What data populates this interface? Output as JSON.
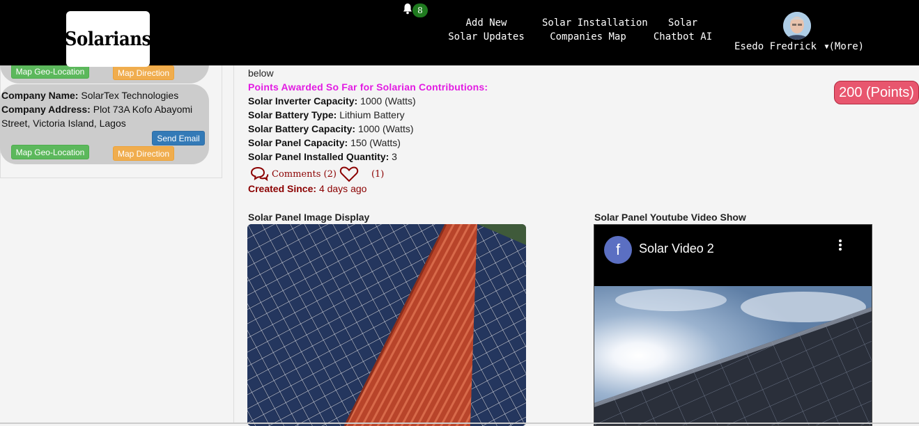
{
  "header": {
    "logo_text": "Solarians",
    "notification_count": "8",
    "nav": [
      {
        "line1": "Add New",
        "line2": "Solar Updates"
      },
      {
        "line1": "Solar Installation",
        "line2": "Companies Map"
      },
      {
        "line1": "Solar",
        "line2": "Chatbot AI"
      }
    ],
    "user_name": "Esedo Fredrick",
    "more_label": "(More)"
  },
  "sidebar": {
    "prev_card": {
      "map_geo_label": "Map Geo-Location",
      "map_direction_label": "Map Direction"
    },
    "card": {
      "company_name_label": "Company Name:",
      "company_name": "SolarTex Technologies",
      "company_address_label": "Company Address:",
      "company_address_line1": "Plot 73A Kofo Abayomi",
      "company_address_line2": "Street, Victoria Island, Lagos",
      "send_email_label": "Send Email",
      "map_geo_label": "Map Geo-Location",
      "map_direction_label": "Map Direction"
    }
  },
  "post": {
    "below_text": "below",
    "points_heading": "Points Awarded So Far for Solarian Contributions:",
    "points_badge": "200 (Points)",
    "specs": [
      {
        "label": "Solar Inverter Capacity:",
        "value": "1000 (Watts)"
      },
      {
        "label": "Solar Battery Type:",
        "value": "Lithium Battery"
      },
      {
        "label": "Solar Battery Capacity:",
        "value": "1000 (Watts)"
      },
      {
        "label": "Solar Panel Capacity:",
        "value": "150 (Watts)"
      },
      {
        "label": "Solar Panel Installed Quantity:",
        "value": "3"
      }
    ],
    "comments_label": "Comments (2)",
    "likes_label": "(1)",
    "created_label": "Created Since:",
    "created_value": "4 days ago",
    "image_section_title": "Solar Panel Image Display",
    "video_section_title": "Solar Panel Youtube Video Show",
    "video": {
      "channel_initial": "f",
      "title": "Solar Video 2"
    }
  },
  "colors": {
    "topbar": "#000000",
    "points_badge": "#e8566e",
    "magenta_heading": "#e21be2",
    "dark_red": "#8b0000",
    "green_button": "#5cb85c",
    "orange_button": "#f0ad4e",
    "blue_button": "#337ab7"
  },
  "icons": {
    "bell": "bell-icon",
    "comments": "comments-icon",
    "heart": "heart-icon",
    "caret": "caret-down-icon",
    "more_vert": "more-vertical-icon"
  }
}
